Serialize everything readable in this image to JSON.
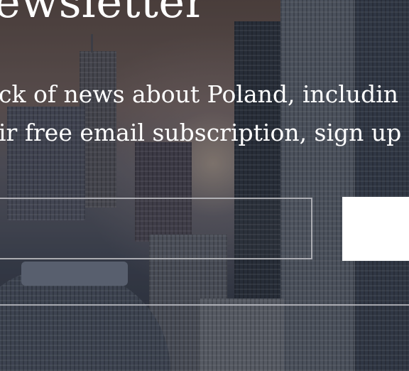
{
  "newsletter": {
    "heading": "ewsletter",
    "lead_line_1": "ck of news about Poland, includin",
    "lead_line_2": "ir free email subscription, sign up",
    "email_value": "",
    "email_placeholder": "",
    "signup_label": ""
  }
}
